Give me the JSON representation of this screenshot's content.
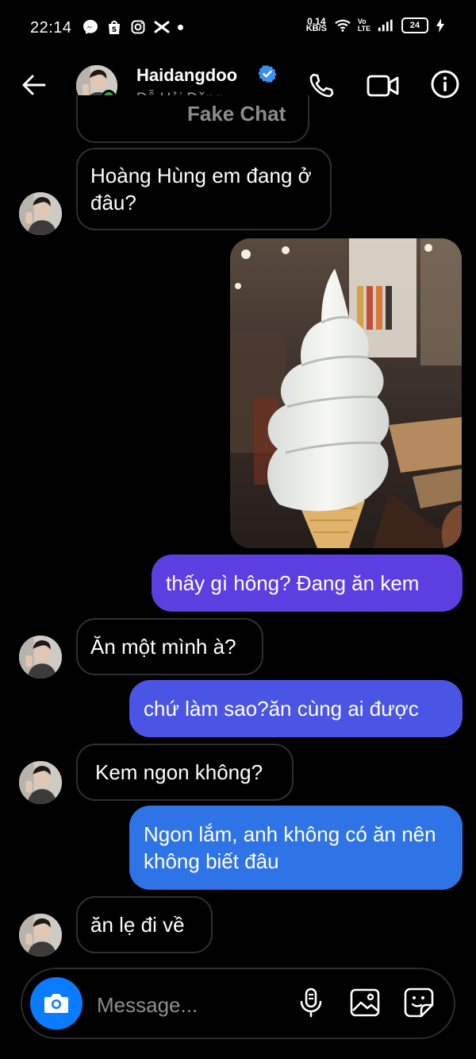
{
  "status_bar": {
    "time": "22:14",
    "net_speed_value": "0.14",
    "net_speed_unit": "KB/S",
    "vo_lte": "Vo LTE",
    "battery": "24"
  },
  "header": {
    "contact_name": "Haidangdoo",
    "contact_subtitle": "Đỗ Hải Đăng",
    "watermark": "Fake Chat",
    "online": true,
    "verified": true
  },
  "messages": [
    {
      "direction": "incoming",
      "text": "Hoàng Hùng em đang ở đâu?"
    },
    {
      "direction": "outgoing",
      "type": "photo",
      "icon": "ice-cream-photo"
    },
    {
      "direction": "outgoing",
      "text": "thấy gì hông? Đang ăn kem"
    },
    {
      "direction": "incoming",
      "text": "Ăn một mình à?"
    },
    {
      "direction": "outgoing",
      "text": "chứ làm sao?ăn cùng ai được"
    },
    {
      "direction": "incoming",
      "text": "Kem ngon không?"
    },
    {
      "direction": "outgoing",
      "text": "Ngon lắm, anh không có ăn nên không biết đâu"
    },
    {
      "direction": "incoming",
      "text": "ăn lẹ đi về"
    }
  ],
  "composer": {
    "placeholder": "Message...",
    "icons": [
      "camera-icon",
      "microphone-icon",
      "gallery-icon",
      "sticker-icon"
    ]
  },
  "colors": {
    "background": "#000000",
    "outgoing_purple": "#5b3fe0",
    "outgoing_blue": "#2f74e6",
    "accent": "#0a7cff",
    "online": "#31a24c",
    "verified": "#3b8ff0"
  }
}
